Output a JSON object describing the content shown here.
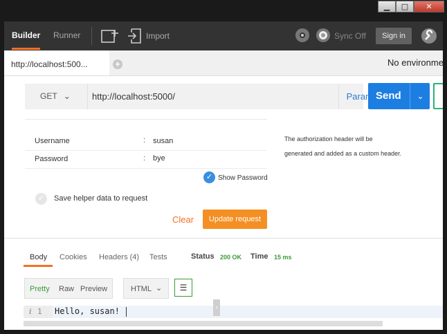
{
  "window": {
    "minimize": "▁",
    "maximize": "□",
    "close": "✕"
  },
  "toolbar": {
    "tabs": [
      "Builder",
      "Runner"
    ],
    "import_label": "Import",
    "sync_label": "Sync Off",
    "signin_label": "Sign in"
  },
  "request_tab": {
    "label": "http://localhost:500...",
    "environment": "No environment"
  },
  "url_bar": {
    "method": "GET",
    "url": "http://localhost:5000/",
    "params_label": "Params",
    "send_label": "Send"
  },
  "auth": {
    "fields": [
      {
        "label": "Username",
        "value": "susan"
      },
      {
        "label": "Password",
        "value": "bye"
      }
    ],
    "show_password_label": "Show Password",
    "note_line1": "The authorization header will be",
    "note_line2": "generated and added as a custom header.",
    "save_helper_label": "Save helper data to request",
    "clear_label": "Clear",
    "update_label": "Update request"
  },
  "response": {
    "tabs": [
      "Body",
      "Cookies",
      "Headers (4)",
      "Tests"
    ],
    "status_label": "Status",
    "status_value": "200 OK",
    "time_label": "Time",
    "time_value": "15 ms",
    "formats": [
      "Pretty",
      "Raw",
      "Preview"
    ],
    "language": "HTML",
    "line_number": "1",
    "body_text": "Hello, susan!"
  },
  "colors": {
    "accent": "#f47023",
    "send": "#1d7ee2",
    "status_ok": "#3a9a3a"
  }
}
